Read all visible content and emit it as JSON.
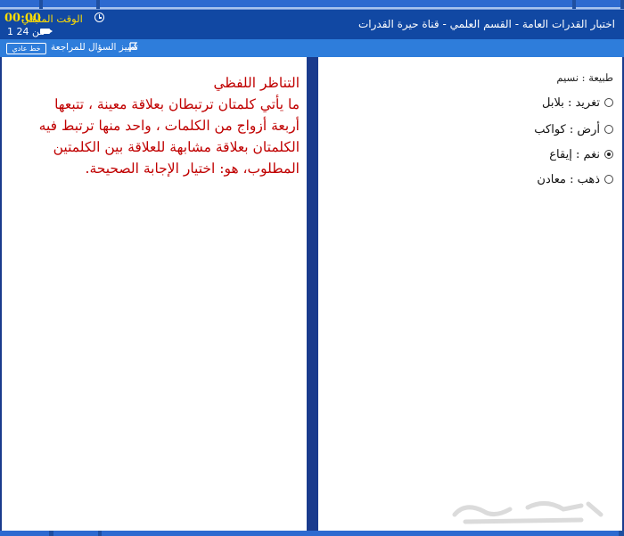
{
  "header": {
    "exam_title": "اختبار القدرات العامة - القسم العلمي - قناة حيرة القدرات",
    "timer_label": "الوقت المتبقي",
    "timer_value": "00:00",
    "question_counter": "1 من 24"
  },
  "review_bar": {
    "mark_for_review_label": "تمييز السؤال للمراجعة",
    "font_button_label": "خط عادي"
  },
  "passage": {
    "heading": "التناظر اللفظي",
    "lines": [
      "ما يأتي كلمتان ترتبطان بعلاقة معينة ، تتبعها",
      "أربعة أزواج من الكلمات ، واحد منها  ترتبط فيه",
      "الكلمتان بعلاقة مشابهة للعلاقة بين الكلمتين",
      "المطلوب، هو: اختيار الإجابة الصحيحة."
    ]
  },
  "question": {
    "stem": "طبيعة : نسيم",
    "options": [
      {
        "label": "تغريد : بلابل",
        "selected": false
      },
      {
        "label": "أرض : كواكب",
        "selected": false
      },
      {
        "label": "نغم : إيقاع",
        "selected": true
      },
      {
        "label": "ذهب : معادن",
        "selected": false
      }
    ]
  },
  "colors": {
    "header_bg": "#1148a3",
    "review_bar_bg": "#2e7ddb",
    "divider": "#1a3b8d",
    "timer_text": "#ffdd00",
    "passage_text": "#c00000"
  },
  "icons": {
    "timer": "clock-icon",
    "counter": "camera-icon",
    "review": "flag-icon"
  }
}
